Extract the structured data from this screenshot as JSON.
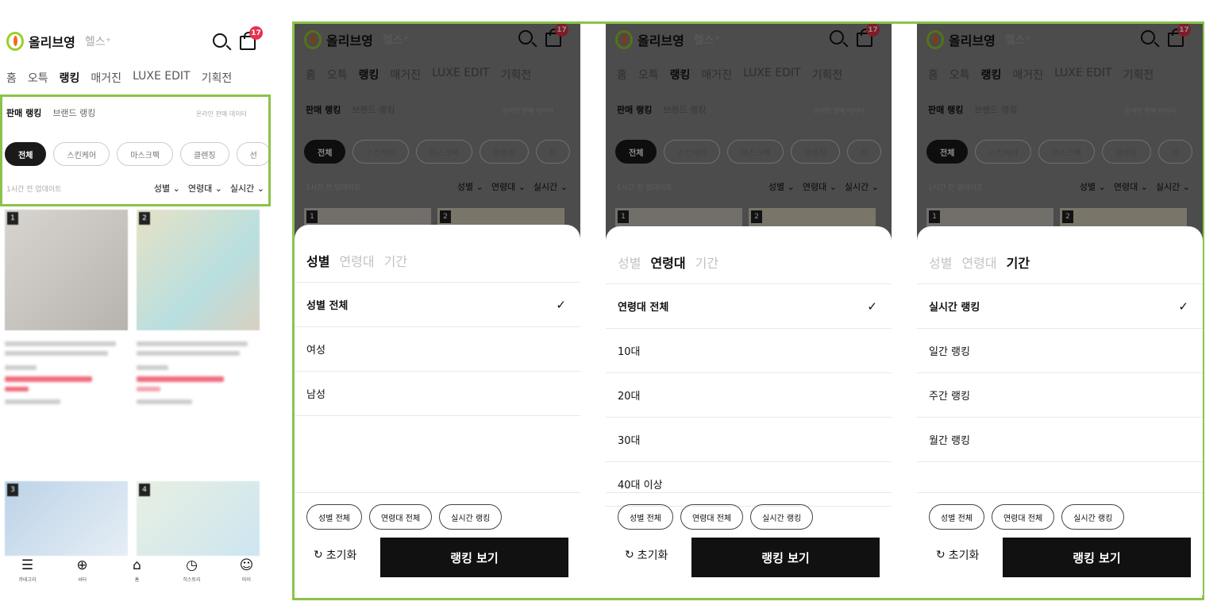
{
  "header": {
    "brand": "올리브영",
    "health": "헬스⁺",
    "cart_count": "17",
    "tabs": [
      "홈",
      "오특",
      "랭킹",
      "매거진",
      "LUXE EDIT",
      "기획전"
    ],
    "active_tab": "랭킹"
  },
  "ranking": {
    "subtabs": [
      "판매 랭킹",
      "브랜드 랭킹"
    ],
    "subnote": "온라인 판매 데이터",
    "chips": [
      "전체",
      "스킨케어",
      "마스크팩",
      "클렌징",
      "선"
    ],
    "updated": "1시간 전 업데이트",
    "filters": [
      "성별 ⌄",
      "연령대 ⌄",
      "실시간 ⌄"
    ]
  },
  "products": [
    {
      "rank": "1"
    },
    {
      "rank": "2"
    },
    {
      "rank": "3"
    },
    {
      "rank": "4"
    }
  ],
  "bottom_nav": [
    "카테고리",
    "셔터",
    "홈",
    "히스토리",
    "마이"
  ],
  "sheet_tabs": [
    "성별",
    "연령대",
    "기간"
  ],
  "sheets": [
    {
      "active": 0,
      "options": [
        "성별 전체",
        "여성",
        "남성"
      ],
      "selected_index": 0
    },
    {
      "active": 1,
      "options": [
        "연령대 전체",
        "10대",
        "20대",
        "30대",
        "40대 이상"
      ],
      "selected_index": 0
    },
    {
      "active": 2,
      "options": [
        "실시간 랭킹",
        "일간 랭킹",
        "주간 랭킹",
        "월간 랭킹"
      ],
      "selected_index": 0
    }
  ],
  "summary_pills": [
    "성별 전체",
    "연령대 전체",
    "실시간 랭킹"
  ],
  "check_mark": "✓",
  "reset_label": "초기화",
  "reset_icon": "↻",
  "view_button": "랭킹 보기",
  "colors": {
    "highlight": "#8bc34a",
    "badge": "#e8324e",
    "button": "#111111"
  }
}
